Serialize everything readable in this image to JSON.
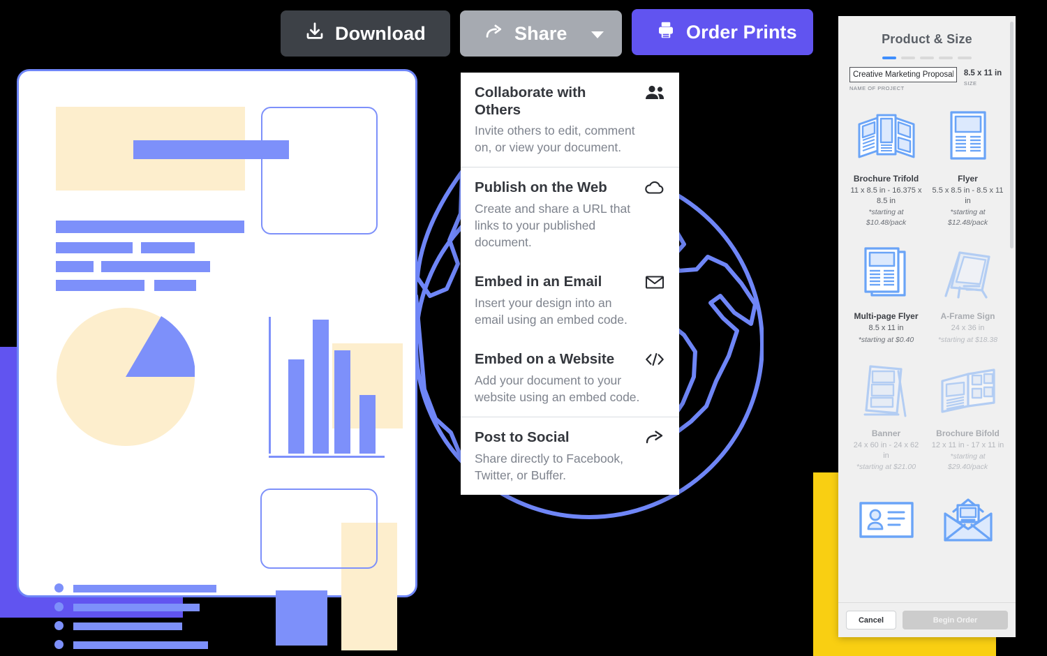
{
  "toolbar": {
    "download_label": "Download",
    "share_label": "Share",
    "order_label": "Order Prints",
    "download_icon": "download-icon",
    "share_icon": "share-arrow-icon",
    "order_icon": "printer-icon",
    "share_caret_icon": "chevron-down-icon"
  },
  "share_menu": {
    "groups": [
      {
        "items": [
          {
            "title": "Collaborate with Others",
            "desc": "Invite others to edit, comment on, or view your document.",
            "icon": "people-icon"
          }
        ]
      },
      {
        "items": [
          {
            "title": "Publish on the Web",
            "desc": "Create and share a URL that links to your published document.",
            "icon": "cloud-icon"
          },
          {
            "title": "Embed in an Email",
            "desc": "Insert your design into an email using an embed code.",
            "icon": "envelope-icon"
          },
          {
            "title": "Embed on a Website",
            "desc": "Add your document to your website using an embed code.",
            "icon": "code-icon"
          }
        ]
      },
      {
        "items": [
          {
            "title": "Post to Social",
            "desc": "Share directly to Facebook, Twitter, or Buffer.",
            "icon": "share-arrow-icon"
          }
        ]
      }
    ]
  },
  "product_panel": {
    "title": "Product & Size",
    "steps": {
      "total": 5,
      "active_index": 0
    },
    "project_name_value": "Creative Marketing Proposal",
    "project_name_label": "NAME OF PROJECT",
    "size_value": "8.5 x 11 in",
    "size_label": "SIZE",
    "products": [
      {
        "name": "Brochure Trifold",
        "dimensions": "11 x 8.5 in - 16.375 x 8.5 in",
        "price": "*starting at $10.48/pack",
        "icon": "brochure-trifold-icon",
        "disabled": false
      },
      {
        "name": "Flyer",
        "dimensions": "5.5 x 8.5 in - 8.5 x 11 in",
        "price": "*starting at $12.48/pack",
        "icon": "flyer-icon",
        "disabled": false
      },
      {
        "name": "Multi-page Flyer",
        "dimensions": "8.5 x 11 in",
        "price": "*starting at $0.40",
        "icon": "multipage-flyer-icon",
        "disabled": false
      },
      {
        "name": "A-Frame Sign",
        "dimensions": "24 x 36 in",
        "price": "*starting at $18.38",
        "icon": "a-frame-sign-icon",
        "disabled": true
      },
      {
        "name": "Banner",
        "dimensions": "24 x 60 in - 24 x 62 in",
        "price": "*starting at $21.00",
        "icon": "banner-icon",
        "disabled": true
      },
      {
        "name": "Brochure Bifold",
        "dimensions": "12 x 11 in - 17 x 11 in",
        "price": "*starting at $29.40/pack",
        "icon": "brochure-bifold-icon",
        "disabled": true
      },
      {
        "name": "",
        "dimensions": "",
        "price": "",
        "icon": "business-card-icon",
        "disabled": false
      },
      {
        "name": "",
        "dimensions": "",
        "price": "",
        "icon": "greeting-card-envelope-icon",
        "disabled": false
      }
    ],
    "cancel_label": "Cancel",
    "begin_order_label": "Begin Order"
  },
  "colors": {
    "accent_purple": "#6154f0",
    "doc_blue": "#7d90fa",
    "cream": "#fdeecd",
    "yellow": "#f9cf12",
    "dark_button": "#3d4147",
    "gray_button": "#a6aab1",
    "product_icon_blue": "#6aa4f7",
    "step_active": "#3f8efc"
  }
}
